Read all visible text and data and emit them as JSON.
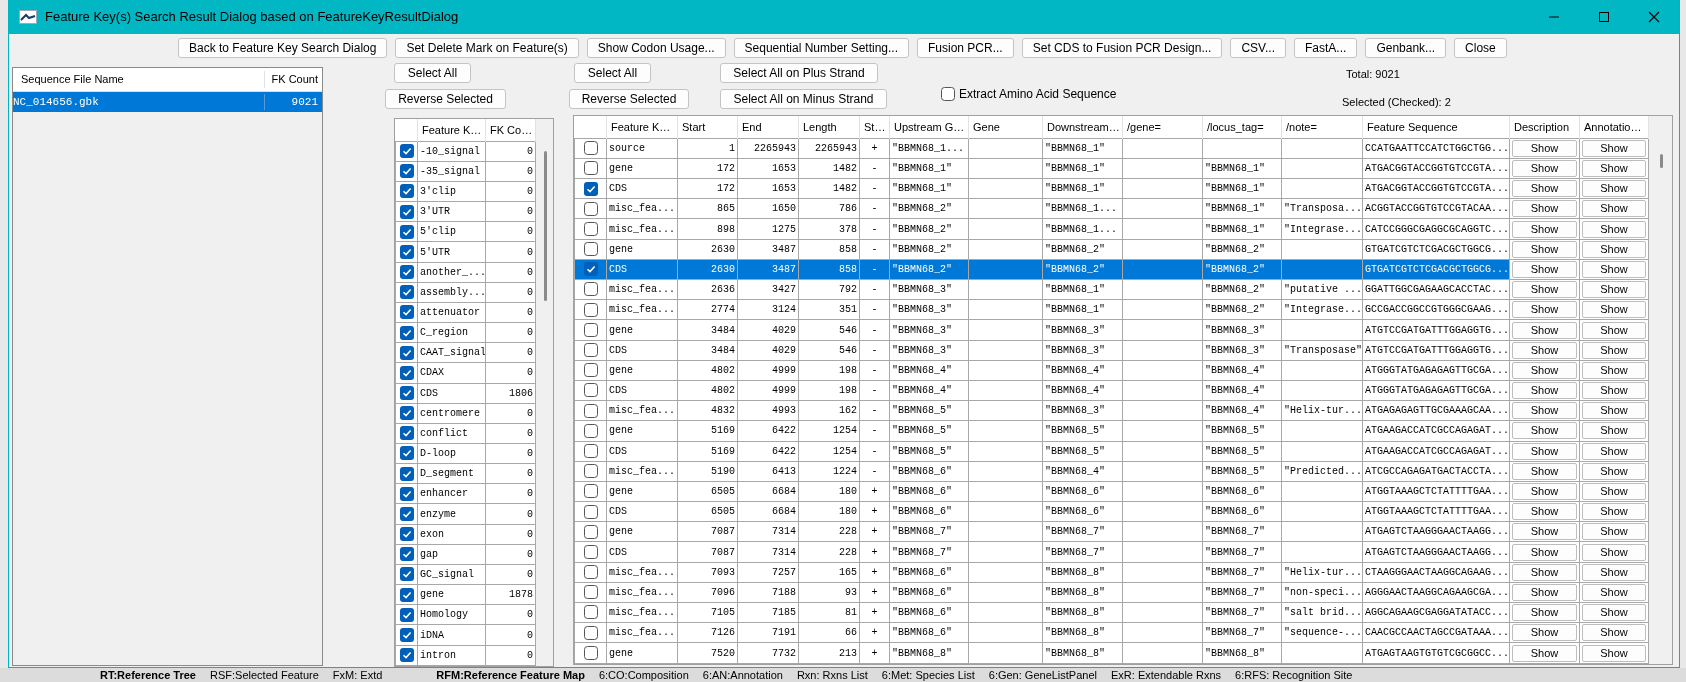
{
  "window": {
    "title": "Feature Key(s) Search Result Dialog based on FeatureKeyResultDialog"
  },
  "toolbar": [
    "Back to Feature Key Search Dialog",
    "Set Delete Mark on Feature(s)",
    "Show Codon Usage...",
    "Sequential Number Setting...",
    "Fusion PCR...",
    "Set CDS to Fusion PCR Design...",
    "CSV...",
    "FastA...",
    "Genbank...",
    "Close"
  ],
  "files": {
    "columns": [
      "Sequence File Name",
      "FK Count"
    ],
    "rows": [
      {
        "name": "NC_014656.gbk",
        "count": "9021",
        "selected": true
      }
    ]
  },
  "key_controls": {
    "select_all": "Select All",
    "reverse_selected": "Reverse Selected"
  },
  "feature_keys": {
    "columns": [
      "Feature K…",
      "FK Co…"
    ],
    "rows": [
      {
        "key": "-10_signal",
        "count": "0",
        "checked": true
      },
      {
        "key": "-35_signal",
        "count": "0",
        "checked": true
      },
      {
        "key": "3'clip",
        "count": "0",
        "checked": true
      },
      {
        "key": "3'UTR",
        "count": "0",
        "checked": true
      },
      {
        "key": "5'clip",
        "count": "0",
        "checked": true
      },
      {
        "key": "5'UTR",
        "count": "0",
        "checked": true
      },
      {
        "key": "another_...",
        "count": "0",
        "checked": true
      },
      {
        "key": "assembly...",
        "count": "0",
        "checked": true
      },
      {
        "key": "attenuator",
        "count": "0",
        "checked": true
      },
      {
        "key": "C_region",
        "count": "0",
        "checked": true
      },
      {
        "key": "CAAT_signal",
        "count": "0",
        "checked": true
      },
      {
        "key": "CDAX",
        "count": "0",
        "checked": true
      },
      {
        "key": "CDS",
        "count": "1806",
        "checked": true
      },
      {
        "key": "centromere",
        "count": "0",
        "checked": true
      },
      {
        "key": "conflict",
        "count": "0",
        "checked": true
      },
      {
        "key": "D-loop",
        "count": "0",
        "checked": true
      },
      {
        "key": "D_segment",
        "count": "0",
        "checked": true
      },
      {
        "key": "enhancer",
        "count": "0",
        "checked": true
      },
      {
        "key": "enzyme",
        "count": "0",
        "checked": true
      },
      {
        "key": "exon",
        "count": "0",
        "checked": true
      },
      {
        "key": "gap",
        "count": "0",
        "checked": true
      },
      {
        "key": "GC_signal",
        "count": "0",
        "checked": true
      },
      {
        "key": "gene",
        "count": "1878",
        "checked": true
      },
      {
        "key": "Homology",
        "count": "0",
        "checked": true
      },
      {
        "key": "iDNA",
        "count": "0",
        "checked": true
      },
      {
        "key": "intron",
        "count": "0",
        "checked": true
      }
    ]
  },
  "result_controls": {
    "select_all": "Select All",
    "reverse_selected": "Reverse Selected",
    "select_plus": "Select All on Plus Strand",
    "select_minus": "Select All on Minus Strand",
    "extract_amino": {
      "label": "Extract Amino Acid Sequence",
      "checked": false
    },
    "total": "Total: 9021",
    "selected_count": "Selected (Checked): 2"
  },
  "results": {
    "columns": [
      "Feature K…",
      "Start",
      "End",
      "Length",
      "St…",
      "Upstream G…",
      "Gene",
      "Downstream…",
      "/gene=",
      "/locus_tag=",
      "/note=",
      "Feature Sequence",
      "Description",
      "Annotatio…"
    ],
    "rows": [
      {
        "checked": false,
        "selected": false,
        "cells": [
          "source",
          "1",
          "2265943",
          "2265943",
          "+",
          "\"BBMN68_1...",
          "",
          "\"BBMN68_1\"",
          "",
          "",
          "",
          "CCATGAATTCCATCTGGCTGG..."
        ],
        "description": "Show",
        "annotation": "Show"
      },
      {
        "checked": false,
        "selected": false,
        "cells": [
          "gene",
          "172",
          "1653",
          "1482",
          "-",
          "\"BBMN68_1\"",
          "",
          "\"BBMN68_1\"",
          "",
          "\"BBMN68_1\"",
          "",
          "ATGACGGTACCGGTGTCCGTA..."
        ],
        "description": "Show",
        "annotation": "Show"
      },
      {
        "checked": true,
        "selected": false,
        "cells": [
          "CDS",
          "172",
          "1653",
          "1482",
          "-",
          "\"BBMN68_1\"",
          "",
          "\"BBMN68_1\"",
          "",
          "\"BBMN68_1\"",
          "",
          "ATGACGGTACCGGTGTCCGTA..."
        ],
        "description": "Show",
        "annotation": "Show"
      },
      {
        "checked": false,
        "selected": false,
        "cells": [
          "misc_fea...",
          "865",
          "1650",
          "786",
          "-",
          "\"BBMN68_2\"",
          "",
          "\"BBMN68_1...",
          "",
          "\"BBMN68_1\"",
          "\"Transposa...",
          "ACGGTACCGGTGTCCGTACAA..."
        ],
        "description": "Show",
        "annotation": "Show"
      },
      {
        "checked": false,
        "selected": false,
        "cells": [
          "misc_fea...",
          "898",
          "1275",
          "378",
          "-",
          "\"BBMN68_2\"",
          "",
          "\"BBMN68_1...",
          "",
          "\"BBMN68_1\"",
          "\"Integrase...",
          "CATCCGGGCGAGGCGCAGGTC..."
        ],
        "description": "Show",
        "annotation": "Show"
      },
      {
        "checked": false,
        "selected": false,
        "cells": [
          "gene",
          "2630",
          "3487",
          "858",
          "-",
          "\"BBMN68_2\"",
          "",
          "\"BBMN68_2\"",
          "",
          "\"BBMN68_2\"",
          "",
          "GTGATCGTCTCGACGCTGGCG..."
        ],
        "description": "Show",
        "annotation": "Show"
      },
      {
        "checked": true,
        "selected": true,
        "cells": [
          "CDS",
          "2630",
          "3487",
          "858",
          "-",
          "\"BBMN68_2\"",
          "",
          "\"BBMN68_2\"",
          "",
          "\"BBMN68_2\"",
          "",
          "GTGATCGTCTCGACGCTGGCG..."
        ],
        "description": "Show",
        "annotation": "Show"
      },
      {
        "checked": false,
        "selected": false,
        "cells": [
          "misc_fea...",
          "2636",
          "3427",
          "792",
          "-",
          "\"BBMN68_3\"",
          "",
          "\"BBMN68_1\"",
          "",
          "\"BBMN68_2\"",
          "\"putative ...",
          "GGATTGGCGAGAAGCACCTAC..."
        ],
        "description": "Show",
        "annotation": "Show"
      },
      {
        "checked": false,
        "selected": false,
        "cells": [
          "misc_fea...",
          "2774",
          "3124",
          "351",
          "-",
          "\"BBMN68_3\"",
          "",
          "\"BBMN68_1\"",
          "",
          "\"BBMN68_2\"",
          "\"Integrase...",
          "GCCGACCGGCCGTGGGCGAAG..."
        ],
        "description": "Show",
        "annotation": "Show"
      },
      {
        "checked": false,
        "selected": false,
        "cells": [
          "gene",
          "3484",
          "4029",
          "546",
          "-",
          "\"BBMN68_3\"",
          "",
          "\"BBMN68_3\"",
          "",
          "\"BBMN68_3\"",
          "",
          "ATGTCCGATGATTTGGAGGTG..."
        ],
        "description": "Show",
        "annotation": "Show"
      },
      {
        "checked": false,
        "selected": false,
        "cells": [
          "CDS",
          "3484",
          "4029",
          "546",
          "-",
          "\"BBMN68_3\"",
          "",
          "\"BBMN68_3\"",
          "",
          "\"BBMN68_3\"",
          "\"Transposase\"",
          "ATGTCCGATGATTTGGAGGTG..."
        ],
        "description": "Show",
        "annotation": "Show"
      },
      {
        "checked": false,
        "selected": false,
        "cells": [
          "gene",
          "4802",
          "4999",
          "198",
          "-",
          "\"BBMN68_4\"",
          "",
          "\"BBMN68_4\"",
          "",
          "\"BBMN68_4\"",
          "",
          "ATGGGTATGAGAGAGTTGCGA..."
        ],
        "description": "Show",
        "annotation": "Show"
      },
      {
        "checked": false,
        "selected": false,
        "cells": [
          "CDS",
          "4802",
          "4999",
          "198",
          "-",
          "\"BBMN68_4\"",
          "",
          "\"BBMN68_4\"",
          "",
          "\"BBMN68_4\"",
          "",
          "ATGGGTATGAGAGAGTTGCGA..."
        ],
        "description": "Show",
        "annotation": "Show"
      },
      {
        "checked": false,
        "selected": false,
        "cells": [
          "misc_fea...",
          "4832",
          "4993",
          "162",
          "-",
          "\"BBMN68_5\"",
          "",
          "\"BBMN68_3\"",
          "",
          "\"BBMN68_4\"",
          "\"Helix-tur...",
          "ATGAGAGAGTTGCGAAAGCAA..."
        ],
        "description": "Show",
        "annotation": "Show"
      },
      {
        "checked": false,
        "selected": false,
        "cells": [
          "gene",
          "5169",
          "6422",
          "1254",
          "-",
          "\"BBMN68_5\"",
          "",
          "\"BBMN68_5\"",
          "",
          "\"BBMN68_5\"",
          "",
          "ATGAAGACCATCGCCAGAGAT..."
        ],
        "description": "Show",
        "annotation": "Show"
      },
      {
        "checked": false,
        "selected": false,
        "cells": [
          "CDS",
          "5169",
          "6422",
          "1254",
          "-",
          "\"BBMN68_5\"",
          "",
          "\"BBMN68_5\"",
          "",
          "\"BBMN68_5\"",
          "",
          "ATGAAGACCATCGCCAGAGAT..."
        ],
        "description": "Show",
        "annotation": "Show"
      },
      {
        "checked": false,
        "selected": false,
        "cells": [
          "misc_fea...",
          "5190",
          "6413",
          "1224",
          "-",
          "\"BBMN68_6\"",
          "",
          "\"BBMN68_4\"",
          "",
          "\"BBMN68_5\"",
          "\"Predicted...",
          "ATCGCCAGAGATGACTACCTA..."
        ],
        "description": "Show",
        "annotation": "Show"
      },
      {
        "checked": false,
        "selected": false,
        "cells": [
          "gene",
          "6505",
          "6684",
          "180",
          "+",
          "\"BBMN68_6\"",
          "",
          "\"BBMN68_6\"",
          "",
          "\"BBMN68_6\"",
          "",
          "ATGGTAAAGCTCTATTTTGAA..."
        ],
        "description": "Show",
        "annotation": "Show"
      },
      {
        "checked": false,
        "selected": false,
        "cells": [
          "CDS",
          "6505",
          "6684",
          "180",
          "+",
          "\"BBMN68_6\"",
          "",
          "\"BBMN68_6\"",
          "",
          "\"BBMN68_6\"",
          "",
          "ATGGTAAAGCTCTATTTTGAA..."
        ],
        "description": "Show",
        "annotation": "Show"
      },
      {
        "checked": false,
        "selected": false,
        "cells": [
          "gene",
          "7087",
          "7314",
          "228",
          "+",
          "\"BBMN68_7\"",
          "",
          "\"BBMN68_7\"",
          "",
          "\"BBMN68_7\"",
          "",
          "ATGAGTCTAAGGGAACTAAGG..."
        ],
        "description": "Show",
        "annotation": "Show"
      },
      {
        "checked": false,
        "selected": false,
        "cells": [
          "CDS",
          "7087",
          "7314",
          "228",
          "+",
          "\"BBMN68_7\"",
          "",
          "\"BBMN68_7\"",
          "",
          "\"BBMN68_7\"",
          "",
          "ATGAGTCTAAGGGAACTAAGG..."
        ],
        "description": "Show",
        "annotation": "Show"
      },
      {
        "checked": false,
        "selected": false,
        "cells": [
          "misc_fea...",
          "7093",
          "7257",
          "165",
          "+",
          "\"BBMN68_6\"",
          "",
          "\"BBMN68_8\"",
          "",
          "\"BBMN68_7\"",
          "\"Helix-tur...",
          "CTAAGGGAACTAAGGCAGAAG..."
        ],
        "description": "Show",
        "annotation": "Show"
      },
      {
        "checked": false,
        "selected": false,
        "cells": [
          "misc_fea...",
          "7096",
          "7188",
          "93",
          "+",
          "\"BBMN68_6\"",
          "",
          "\"BBMN68_8\"",
          "",
          "\"BBMN68_7\"",
          "\"non-speci...",
          "AGGGAACTAAGGCAGAAGCGA..."
        ],
        "description": "Show",
        "annotation": "Show"
      },
      {
        "checked": false,
        "selected": false,
        "cells": [
          "misc_fea...",
          "7105",
          "7185",
          "81",
          "+",
          "\"BBMN68_6\"",
          "",
          "\"BBMN68_8\"",
          "",
          "\"BBMN68_7\"",
          "\"salt brid...",
          "AGGCAGAAGCGAGGATATACC..."
        ],
        "description": "Show",
        "annotation": "Show"
      },
      {
        "checked": false,
        "selected": false,
        "cells": [
          "misc_fea...",
          "7126",
          "7191",
          "66",
          "+",
          "\"BBMN68_6\"",
          "",
          "\"BBMN68_8\"",
          "",
          "\"BBMN68_7\"",
          "\"sequence-...",
          "CAACGCCAACTAGCCGATAAA..."
        ],
        "description": "Show",
        "annotation": "Show"
      },
      {
        "checked": false,
        "selected": false,
        "cells": [
          "gene",
          "7520",
          "7732",
          "213",
          "+",
          "\"BBMN68_8\"",
          "",
          "\"BBMN68_8\"",
          "",
          "\"BBMN68_8\"",
          "",
          "ATGAGTAAGTGTGTCGCGGCC..."
        ],
        "description": "Show",
        "annotation": "Show"
      }
    ]
  },
  "background_tabs": [
    {
      "label": "RT:Reference Tree",
      "active": true
    },
    {
      "label": "RSF:Selected Feature",
      "active": false
    },
    {
      "label": "FxM: Extd",
      "active": false
    },
    {
      "label": "RFM:Reference Feature Map",
      "active": true
    },
    {
      "label": "6:CO:Composition",
      "active": false
    },
    {
      "label": "6:AN:Annotation",
      "active": false
    },
    {
      "label": "Rxn: Rxns List",
      "active": false
    },
    {
      "label": "6:Met: Species List",
      "active": false
    },
    {
      "label": "6:Gen: GeneListPanel",
      "active": false
    },
    {
      "label": "ExR: Extendable Rxns",
      "active": false
    },
    {
      "label": "6:RFS: Recognition Site",
      "active": false
    }
  ]
}
